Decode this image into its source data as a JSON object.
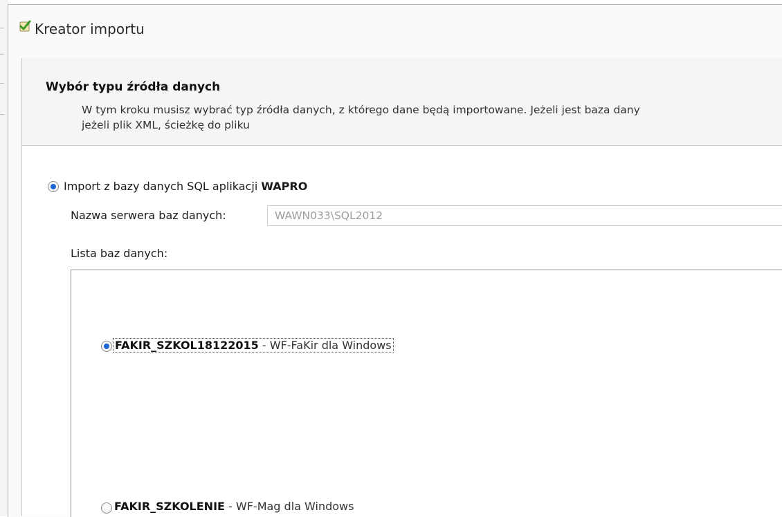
{
  "window": {
    "title": "Kreator importu"
  },
  "step": {
    "title": "Wybór typu źródła danych",
    "description": "W tym kroku musisz wybrać typ źródła danych, z którego dane będą importowane. Jeżeli jest baza dany\njeżeli plik XML, ścieżkę do pliku"
  },
  "source_option": {
    "label_prefix": "Import z bazy danych SQL aplikacji ",
    "label_bold": "WAPRO",
    "selected": true
  },
  "server": {
    "label": "Nazwa serwera baz danych:",
    "value": "WAWN033\\SQL2012"
  },
  "database_list": {
    "label": "Lista baz danych:",
    "items": [
      {
        "name": "FAKIR_SZKOL18122015",
        "app": " - WF-FaKir dla Windows",
        "selected": true
      },
      {
        "name": "FAKIR_SZKOLENIE",
        "app": " - WF-Mag dla Windows",
        "selected": false
      }
    ]
  },
  "colors": {
    "accent": "#1e66d6",
    "header_bg": "#f5f5f5",
    "input_text": "#9e9e9e"
  },
  "icons": {
    "title": "import-wizard-check-icon"
  }
}
